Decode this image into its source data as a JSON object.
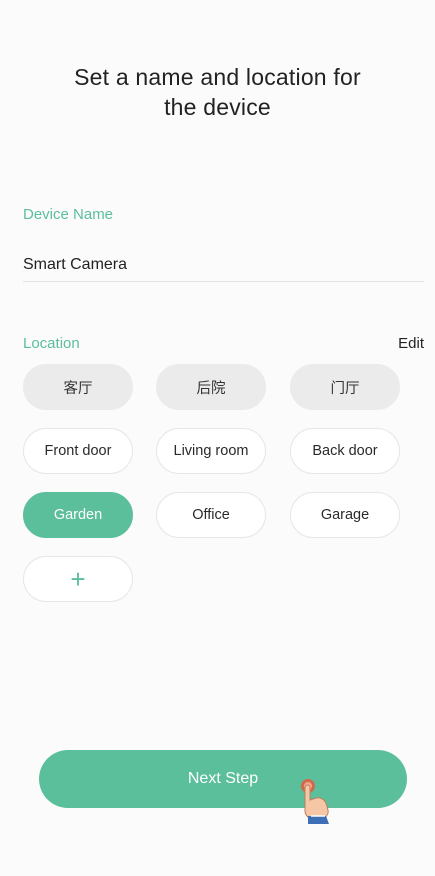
{
  "title": {
    "line1": "Set a name and location for",
    "line2": "the device"
  },
  "device_name": {
    "label": "Device Name",
    "value": "Smart Camera"
  },
  "location": {
    "label": "Location",
    "edit_label": "Edit",
    "chips": [
      {
        "label": "客厅",
        "style": "grey"
      },
      {
        "label": "后院",
        "style": "grey"
      },
      {
        "label": "门厅",
        "style": "grey"
      },
      {
        "label": "Front door",
        "style": "outline"
      },
      {
        "label": "Living room",
        "style": "outline"
      },
      {
        "label": "Back door",
        "style": "outline"
      },
      {
        "label": "Garden",
        "style": "selected"
      },
      {
        "label": "Office",
        "style": "outline"
      },
      {
        "label": "Garage",
        "style": "outline"
      }
    ],
    "add_label": "+"
  },
  "next_button": {
    "label": "Next Step"
  },
  "colors": {
    "accent": "#5bbf9c",
    "grey_chip": "#ebebeb"
  },
  "icons": {
    "pointer": "pointing-hand-icon"
  }
}
